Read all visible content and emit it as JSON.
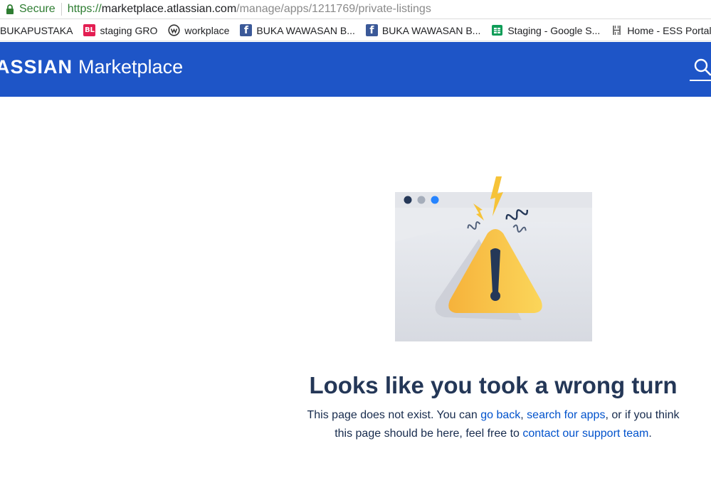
{
  "browser": {
    "secure_label": "Secure",
    "url_scheme": "https://",
    "url_host": "marketplace.atlassian.com",
    "url_path": "/manage/apps/1211769/private-listings",
    "bookmarks": [
      {
        "label": "BUKAPUSTAKA",
        "icon": "none"
      },
      {
        "label": "staging GRO",
        "icon": "bukalapak-icon",
        "icon_text": "BL",
        "color": "#e31e52"
      },
      {
        "label": "workplace",
        "icon": "workplace-icon"
      },
      {
        "label": "BUKA WAWASAN B...",
        "icon": "facebook-icon",
        "icon_text": "f",
        "color": "#3b5998"
      },
      {
        "label": "BUKA WAWASAN B...",
        "icon": "facebook-icon",
        "icon_text": "f",
        "color": "#3b5998"
      },
      {
        "label": "Staging - Google S...",
        "icon": "google-sheets-icon",
        "color": "#0f9d58"
      },
      {
        "label": "Home - ESS Portal",
        "icon": "ess-portal-icon"
      }
    ]
  },
  "header": {
    "brand_atlassian": "ASSIAN",
    "brand_product": "Marketplace",
    "color": "#1e55c7"
  },
  "error": {
    "illustration": "warning-browser-illustration",
    "title": "Looks like you took a wrong turn",
    "message_1": "This page does not exist. You can ",
    "link_go_back": "go back",
    "message_2": ", ",
    "link_search_apps": "search for apps",
    "message_3": ", or if you think this page should be here, feel free to ",
    "link_contact_support": "contact our support team",
    "message_4": "."
  }
}
